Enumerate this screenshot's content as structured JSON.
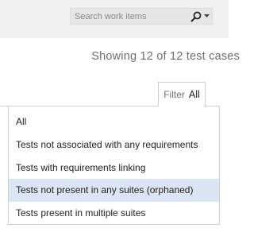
{
  "search": {
    "placeholder": "Search work items",
    "icon": "search-icon",
    "dropdown_icon": "caret-down-icon"
  },
  "summary": {
    "showing_text": "Showing 12 of 12 test cases"
  },
  "filter": {
    "label": "Filter",
    "value": "All"
  },
  "menu": {
    "items": [
      {
        "label": "All",
        "selected": false
      },
      {
        "label": "Tests not associated with any requirements",
        "selected": false
      },
      {
        "label": "Tests with requirements linking",
        "selected": false
      },
      {
        "label": "Tests not present in any suites (orphaned)",
        "selected": true
      },
      {
        "label": "Tests present in multiple suites",
        "selected": false
      }
    ]
  },
  "colors": {
    "topbar_bg": "#f0f0f0",
    "search_bg": "#e6e6e6",
    "selected_item_bg": "#dbe5f5",
    "muted_text": "#6f6f6f"
  }
}
